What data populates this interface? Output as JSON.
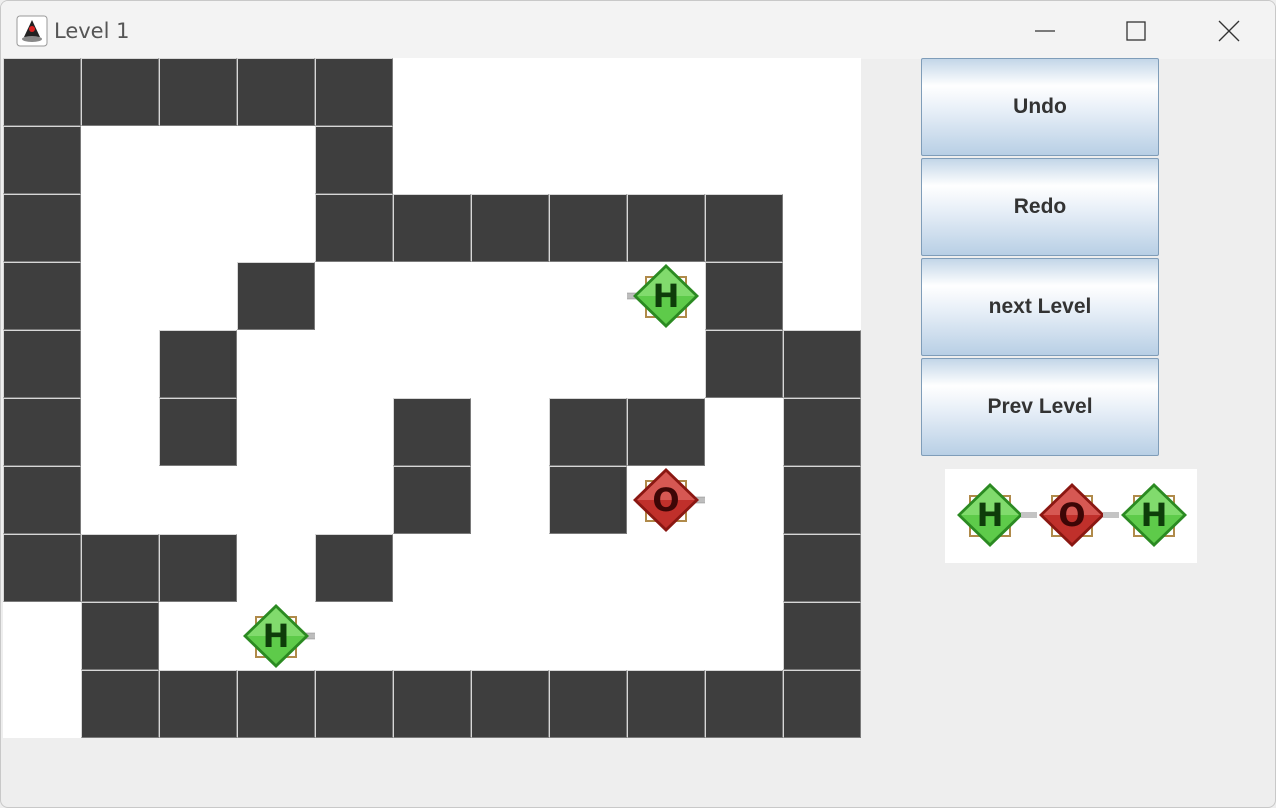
{
  "window": {
    "title": "Level 1"
  },
  "icons": {
    "app": "java-duke-icon",
    "minimize": "minimize-icon",
    "maximize": "maximize-icon",
    "close": "close-icon"
  },
  "controls": {
    "undo": "Undo",
    "redo": "Redo",
    "next": "next Level",
    "prev": "Prev Level"
  },
  "board": {
    "cols": 11,
    "rows": 10,
    "grid": [
      "#####......",
      "#...#......",
      "#...######.",
      "#..#.....#.",
      "#.#......##",
      "#.#..#.##.#",
      "#....#.#..#",
      "###.#.....#",
      ".#........#",
      ".##########"
    ],
    "atoms": [
      {
        "element": "H",
        "row": 3,
        "col": 8,
        "bond": "left"
      },
      {
        "element": "O",
        "row": 6,
        "col": 8,
        "bond": "right"
      },
      {
        "element": "H",
        "row": 8,
        "col": 3,
        "bond": "right"
      }
    ]
  },
  "goal_molecule": {
    "atoms": [
      "H",
      "O",
      "H"
    ]
  },
  "colors": {
    "wall": "#3e3e3e",
    "floor": "#ffffff",
    "hydrogen": "#5ecb4a",
    "oxygen": "#c0302b"
  }
}
